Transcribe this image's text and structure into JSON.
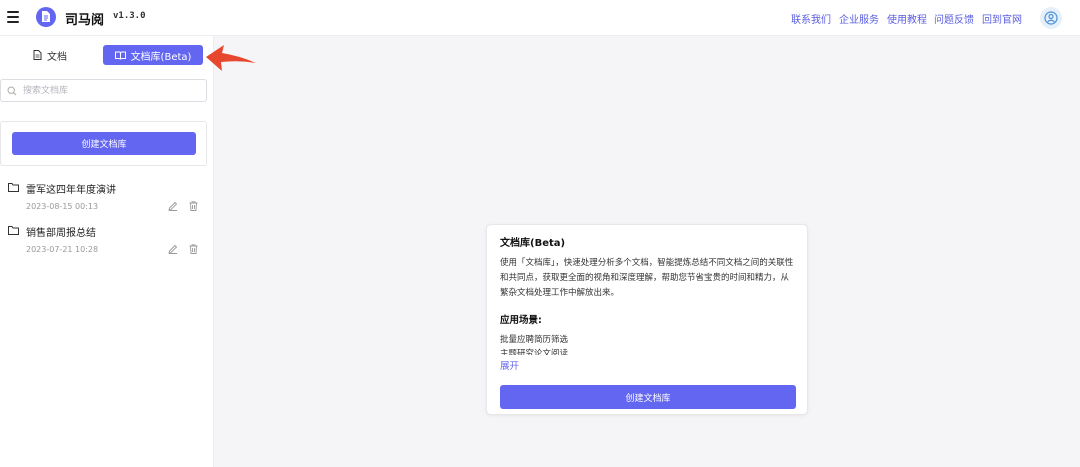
{
  "header": {
    "app_title": "司马阅",
    "version": "v1.3.0",
    "nav_links": [
      "联系我们",
      "企业服务",
      "使用教程",
      "问题反馈",
      "回到官网"
    ]
  },
  "sidebar": {
    "tabs": {
      "docs": "文档",
      "library": "文档库(Beta)"
    },
    "search_placeholder": "搜索文档库",
    "create_button": "创建文档库",
    "libraries": [
      {
        "name": "雷军这四年年度演讲",
        "date": "2023-08-15 00:13"
      },
      {
        "name": "销售部周报总结",
        "date": "2023-07-21 10:28"
      }
    ]
  },
  "main": {
    "card": {
      "title": "文档库(Beta)",
      "description": "使用「文档库」，快速处理分析多个文档，智能提炼总结不同文档之间的关联性和共同点，获取更全面的视角和深度理解，帮助您节省宝贵的时间和精力，从繁杂文档处理工作中解放出来。",
      "scenarios_title": "应用场景:",
      "scenarios": [
        "批量应聘简历筛选",
        "主题研究论文阅读"
      ],
      "expand_label": "展开",
      "create_button": "创建文档库"
    }
  },
  "colors": {
    "accent": "#6366f1",
    "arrow": "#e8472f"
  }
}
